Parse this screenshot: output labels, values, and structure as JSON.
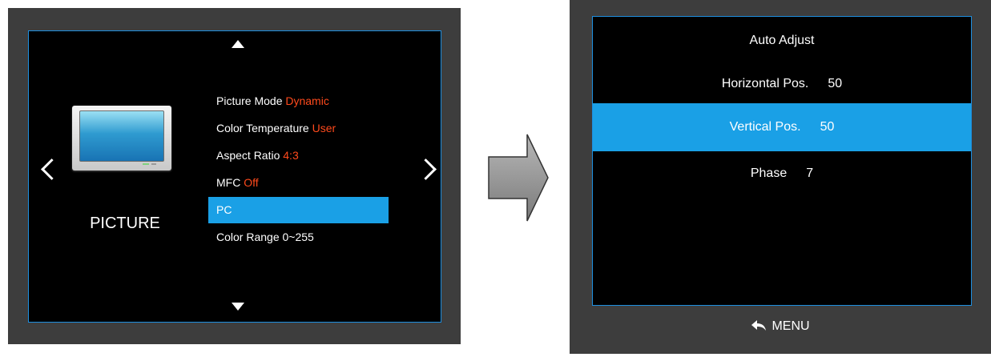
{
  "left_panel": {
    "category_label": "PICTURE",
    "menu_items": [
      {
        "label": "Picture Mode",
        "value": "Dynamic"
      },
      {
        "label": "Color Temperature",
        "value": "User"
      },
      {
        "label": "Aspect Ratio",
        "value": "4:3"
      },
      {
        "label": "MFC",
        "value": "Off"
      },
      {
        "label": "PC",
        "value": ""
      },
      {
        "label": "Color Range 0~255",
        "value": ""
      }
    ],
    "selected_index": 4
  },
  "right_panel": {
    "items": [
      {
        "label": "Auto Adjust",
        "value": ""
      },
      {
        "label": "Horizontal Pos.",
        "value": "50"
      },
      {
        "label": "Vertical Pos.",
        "value": "50"
      },
      {
        "label": "Phase",
        "value": "7"
      }
    ],
    "selected_index": 2,
    "back_hint": "MENU"
  },
  "colors": {
    "highlight": "#1aa0e6",
    "value_text": "#ff4a1c",
    "frame": "#3d3d3d",
    "border": "#1e8fe0"
  },
  "icons": [
    "up-triangle-icon",
    "down-triangle-icon",
    "chevron-left-icon",
    "chevron-right-icon",
    "tv-icon",
    "return-arrow-icon",
    "transition-arrow-icon"
  ]
}
